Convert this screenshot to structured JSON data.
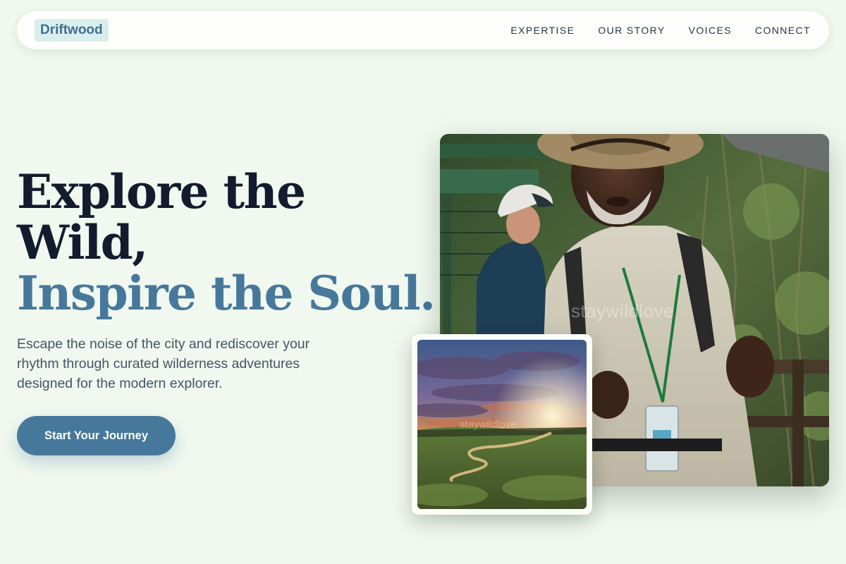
{
  "brand": {
    "name": "Driftwood"
  },
  "nav": {
    "links": [
      {
        "label": "EXPERTISE"
      },
      {
        "label": "OUR STORY"
      },
      {
        "label": "VOICES"
      },
      {
        "label": "CONNECT"
      }
    ]
  },
  "hero": {
    "headline_line1": "Explore the",
    "headline_line2": "Wild,",
    "headline_accent": "Inspire the Soul.",
    "subtitle": "Escape the noise of the city and rediscover your rhythm through curated wilderness adventures designed for the modern explorer.",
    "cta_label": "Start Your Journey"
  },
  "images": {
    "main_watermark": "staywildlove",
    "inset_watermark": "staywildlove"
  },
  "colors": {
    "background": "#f0f8ef",
    "accent": "#46789b",
    "headline": "#131b2e",
    "logo_bg": "#dbeeee"
  }
}
